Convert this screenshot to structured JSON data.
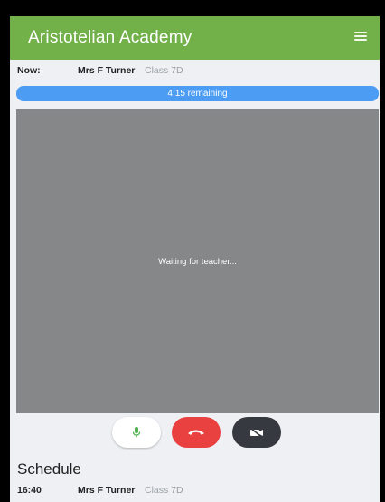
{
  "header": {
    "title": "Aristotelian Academy",
    "menu_icon": "hamburger-menu-icon"
  },
  "now": {
    "label": "Now:",
    "teacher": "Mrs F Turner",
    "class": "Class 7D"
  },
  "timer": {
    "text": "4:15 remaining",
    "color": "#4c9cf4"
  },
  "video": {
    "status": "Waiting for teacher..."
  },
  "controls": [
    {
      "name": "microphone",
      "icon": "microphone-icon",
      "color": "#ffffff"
    },
    {
      "name": "end-call",
      "icon": "hang-up-icon",
      "color": "#e94040"
    },
    {
      "name": "camera",
      "icon": "camera-off-icon",
      "color": "#363a40"
    }
  ],
  "schedule": {
    "title": "Schedule",
    "items": [
      {
        "time": "16:40",
        "teacher": "Mrs F Turner",
        "class": "Class 7D"
      }
    ]
  },
  "colors": {
    "brand": "#72b04a",
    "background": "#eef0f4"
  }
}
